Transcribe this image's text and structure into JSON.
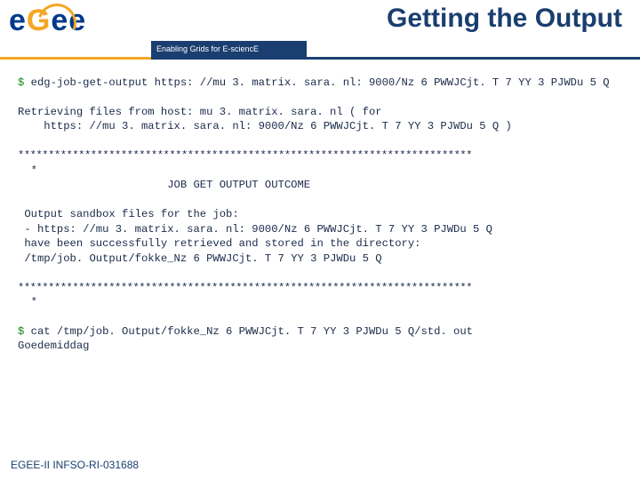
{
  "header": {
    "title": "Getting the Output",
    "tagline": "Enabling Grids for E-sciencE",
    "logo": {
      "e1": "e",
      "g": "G",
      "e2": "e",
      "e3": "e"
    }
  },
  "term": {
    "prompt1": "$ ",
    "cmd1": "edg-job-get-output https: //mu 3. matrix. sara. nl: 9000/Nz 6 PWWJCjt. T 7 YY 3 PJWDu 5 Q",
    "blank1": "",
    "retrieve1": "Retrieving files from host: mu 3. matrix. sara. nl ( for",
    "retrieve2": "    https: //mu 3. matrix. sara. nl: 9000/Nz 6 PWWJCjt. T 7 YY 3 PJWDu 5 Q )",
    "blank2": "",
    "rule1": "***************************************************************************",
    "star1": "  *",
    "heading": "                       JOB GET OUTPUT OUTCOME",
    "blank3": "",
    "out1": " Output sandbox files for the job:",
    "out2": " - https: //mu 3. matrix. sara. nl: 9000/Nz 6 PWWJCjt. T 7 YY 3 PJWDu 5 Q",
    "out3": " have been successfully retrieved and stored in the directory:",
    "out4": " /tmp/job. Output/fokke_Nz 6 PWWJCjt. T 7 YY 3 PJWDu 5 Q",
    "blank4": "",
    "rule2": "***************************************************************************",
    "star2": "  *",
    "blank5": "",
    "prompt2": "$ ",
    "cmd2": "cat /tmp/job. Output/fokke_Nz 6 PWWJCjt. T 7 YY 3 PJWDu 5 Q/std. out",
    "result": "Goedemiddag"
  },
  "footer": {
    "text": "EGEE-II INFSO-RI-031688"
  }
}
